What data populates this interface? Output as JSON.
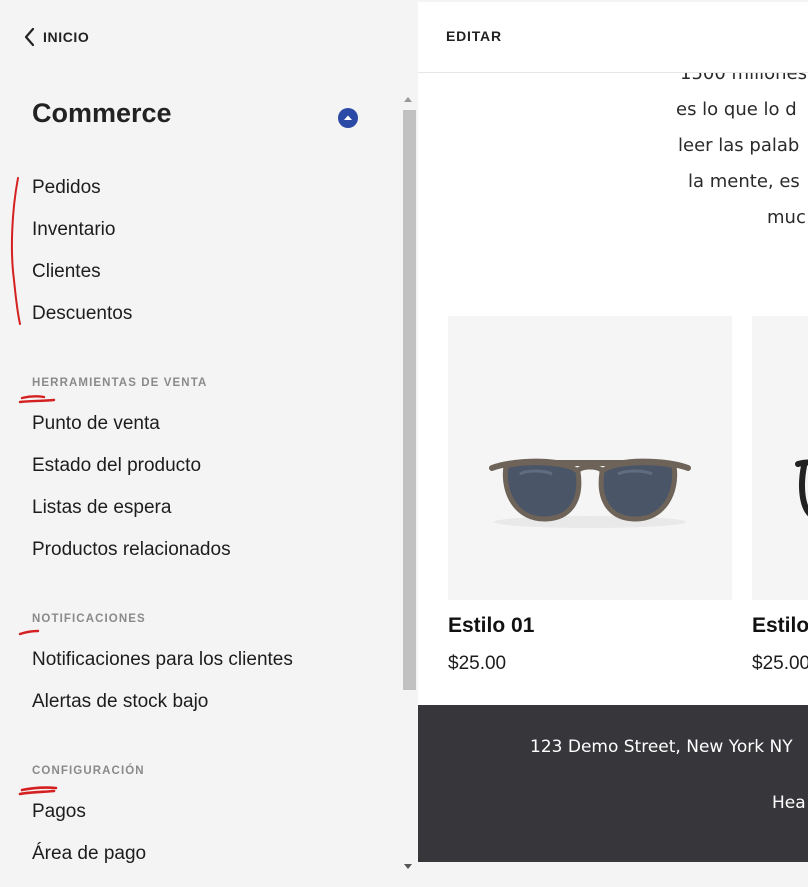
{
  "sidebar": {
    "back_label": "INICIO",
    "title": "Commerce",
    "main_items": [
      {
        "label": "Pedidos"
      },
      {
        "label": "Inventario"
      },
      {
        "label": "Clientes"
      },
      {
        "label": "Descuentos"
      }
    ],
    "sections": [
      {
        "heading": "HERRAMIENTAS DE VENTA",
        "items": [
          {
            "label": "Punto de venta"
          },
          {
            "label": "Estado del producto"
          },
          {
            "label": "Listas de espera"
          },
          {
            "label": "Productos relacionados"
          }
        ]
      },
      {
        "heading": "NOTIFICACIONES",
        "items": [
          {
            "label": "Notificaciones para los clientes"
          },
          {
            "label": "Alertas de stock bajo"
          }
        ]
      },
      {
        "heading": "CONFIGURACIÓN",
        "items": [
          {
            "label": "Pagos"
          },
          {
            "label": "Área de pago"
          }
        ]
      }
    ],
    "collapse_icon": "chevron-up-icon",
    "accent_color": "#2a4aa5"
  },
  "preview": {
    "edit_label": "EDITAR",
    "text_lines": [
      "1500 millones",
      "es lo que lo d",
      "leer las palab",
      "la mente, es",
      "muc"
    ],
    "products": [
      {
        "name": "Estilo 01",
        "price": "$25.00",
        "image": "sunglasses"
      },
      {
        "name": "Estilo",
        "price": "$25.00",
        "image": "sunglasses"
      }
    ],
    "footer": {
      "address": "123 Demo Street, New York NY",
      "line2": "Hea"
    },
    "footer_color": "#37373b"
  },
  "annotation_color": "#d42020"
}
